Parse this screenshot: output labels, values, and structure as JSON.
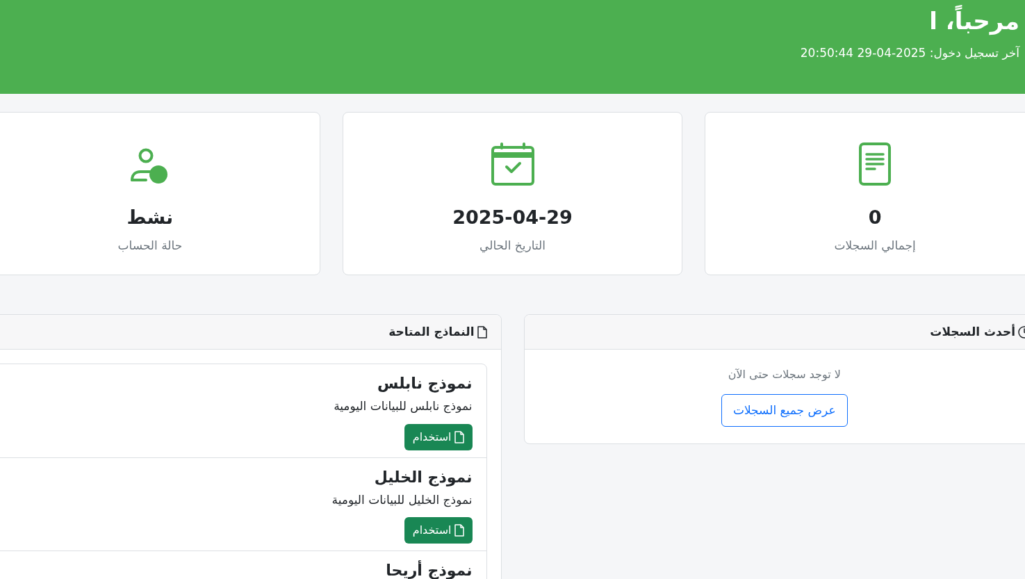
{
  "header": {
    "title": "مرحباً، ا",
    "last_login": "آخر تسجيل دخول: 2025-04-29 20:50:44"
  },
  "stats": [
    {
      "kind": "records",
      "value": "0",
      "label": "إجمالي السجلات"
    },
    {
      "kind": "date",
      "value": "2025-04-29",
      "label": "التاريخ الحالي"
    },
    {
      "kind": "status",
      "value": "نشط",
      "label": "حالة الحساب"
    }
  ],
  "recent_records": {
    "title": "أحدث السجلات",
    "empty_text": "لا توجد سجلات حتى الآن",
    "button": "عرض جميع السجلات"
  },
  "templates": {
    "title": "النماذج المتاحة",
    "items": [
      {
        "name": "نموذج نابلس",
        "description": "نموذج نابلس للبيانات اليومية",
        "button": "استخدام"
      },
      {
        "name": "نموذج الخليل",
        "description": "نموذج الخليل للبيانات اليومية",
        "button": "استخدام"
      },
      {
        "name": "نموذج أريحا"
      }
    ]
  }
}
